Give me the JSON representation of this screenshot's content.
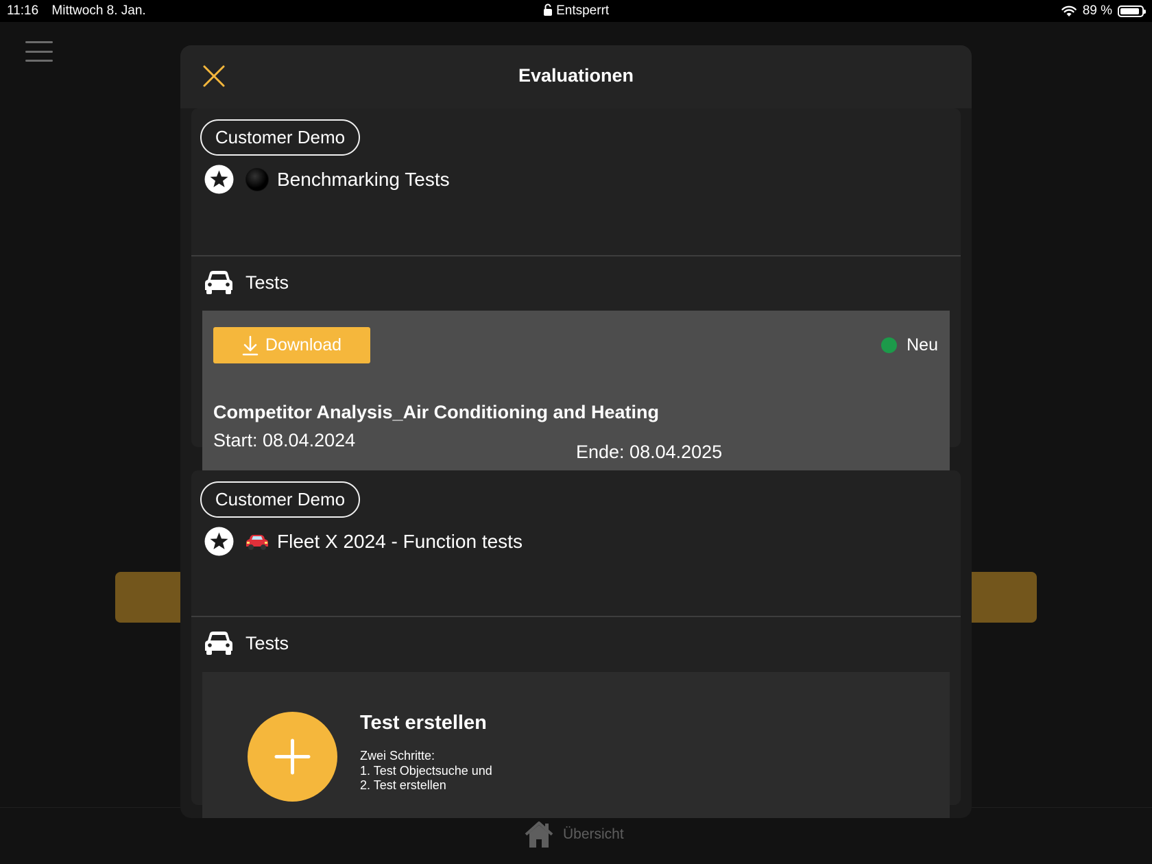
{
  "status_bar": {
    "time": "11:16",
    "date": "Mittwoch 8. Jan.",
    "lock_status": "Entsperrt",
    "battery": "89 %",
    "battery_level": 0.89
  },
  "bottom_nav": {
    "home_label": "Übersicht"
  },
  "modal": {
    "title": "Evaluationen"
  },
  "evaluations": [
    {
      "customer": "Customer Demo",
      "name": "Benchmarking Tests",
      "section_label": "Tests",
      "test": {
        "download_label": "Download",
        "status": "Neu",
        "title": "Competitor Analysis_Air Conditioning and Heating",
        "start": "Start: 08.04.2024",
        "end": "Ende: 08.04.2025"
      }
    },
    {
      "customer": "Customer Demo",
      "emoji": "🚗",
      "name": "Fleet X 2024 - Function tests",
      "section_label": "Tests",
      "create": {
        "title": "Test erstellen",
        "desc_line1": "Zwei Schritte:",
        "desc_line2": "1. Test Objectsuche und",
        "desc_line3": "2. Test erstellen"
      }
    }
  ],
  "colors": {
    "accent": "#f5b73c",
    "status_new": "#1c9a4a",
    "card_bg": "#222222",
    "test_bg": "#4d4d4d"
  }
}
